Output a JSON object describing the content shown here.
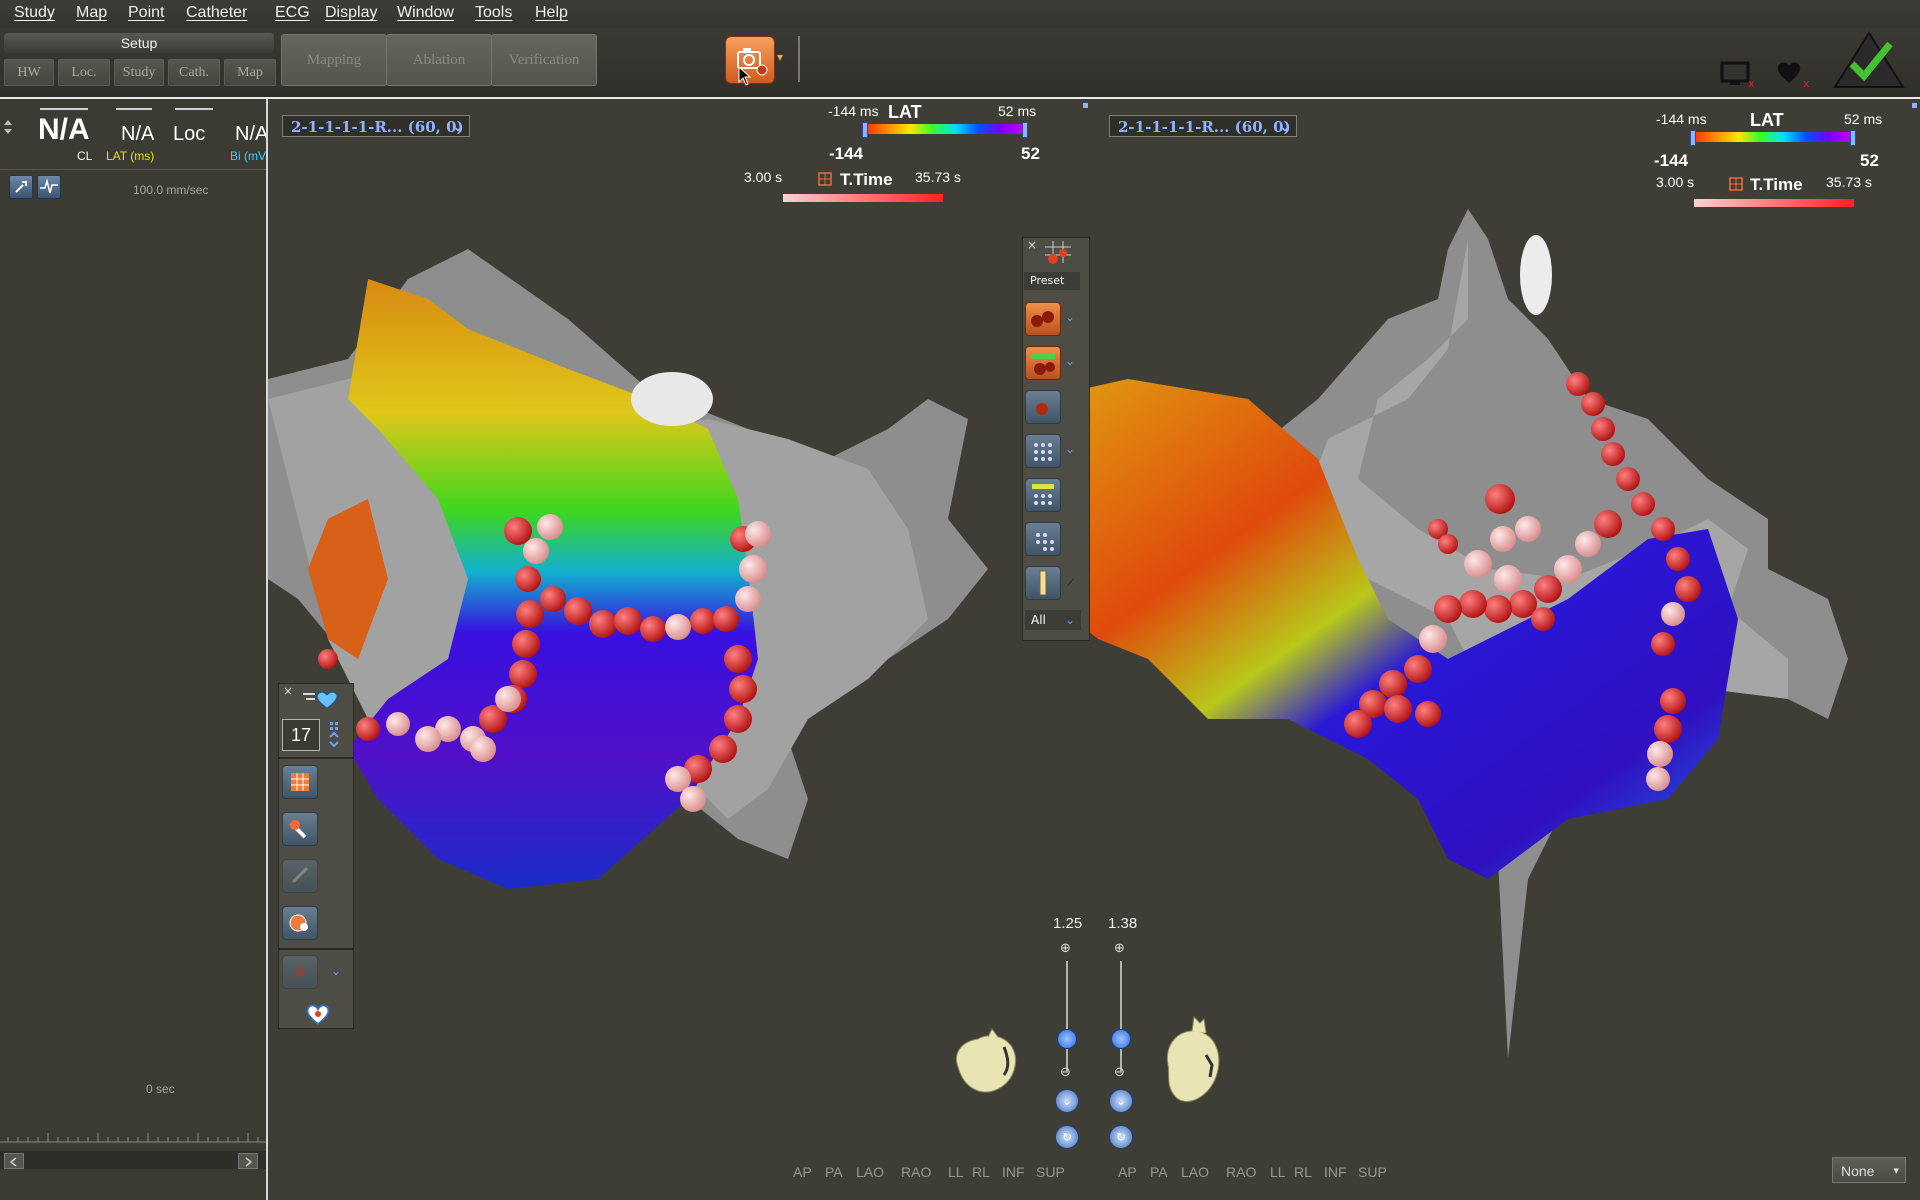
{
  "menu": [
    "Study",
    "Map",
    "Point",
    "Catheter",
    "ECG",
    "Display",
    "Window",
    "Tools",
    "Help"
  ],
  "toolbar": {
    "setup_label": "Setup",
    "sub_tabs": [
      "HW",
      "Loc.",
      "Study",
      "Cath.",
      "Map"
    ],
    "phase_buttons": [
      "Mapping",
      "Ablation",
      "Verification"
    ]
  },
  "left_panel": {
    "stats": [
      {
        "value": "N/A",
        "label": "CL",
        "label_color": "#ffffff"
      },
      {
        "value": "N/A",
        "label": "LAT (ms)",
        "label_color": "#e8e400"
      },
      {
        "value": "Loc",
        "label": "",
        "label_color": "#ffffff"
      },
      {
        "value": "N/A",
        "label": "Bi (mV)",
        "label_color": "#36d2ff"
      }
    ],
    "speed": "100.0 mm/sec",
    "time_readout": "0 sec"
  },
  "left_view": {
    "map_name": "2-1-1-1-1-R... (60, 0)",
    "lat": {
      "title": "LAT",
      "min_ms": "-144 ms",
      "max_ms": "52 ms",
      "min": "-144",
      "max": "52"
    },
    "ttime": {
      "title": "T.Time",
      "min": "3.00 s",
      "max": "35.73 s"
    }
  },
  "right_view": {
    "map_name": "2-1-1-1-1-R... (60, 0)",
    "lat": {
      "title": "LAT",
      "min_ms": "-144 ms",
      "max_ms": "52 ms",
      "min": "-144",
      "max": "52"
    },
    "ttime": {
      "title": "T.Time",
      "min": "3.00 s",
      "max": "35.73 s"
    }
  },
  "point_palette": {
    "preset_label": "Preset",
    "filter_value": "All"
  },
  "tag_palette": {
    "counter": "17"
  },
  "zoom": {
    "left": "1.25",
    "right": "1.38"
  },
  "view_buttons": [
    "AP",
    "PA",
    "LAO",
    "RAO",
    "LL",
    "RL",
    "INF",
    "SUP"
  ],
  "view_buttons_right": [
    "AP",
    "PA",
    "LAO",
    "RAO",
    "LL",
    "RL",
    "INF",
    "SUP"
  ],
  "none_select": "None"
}
